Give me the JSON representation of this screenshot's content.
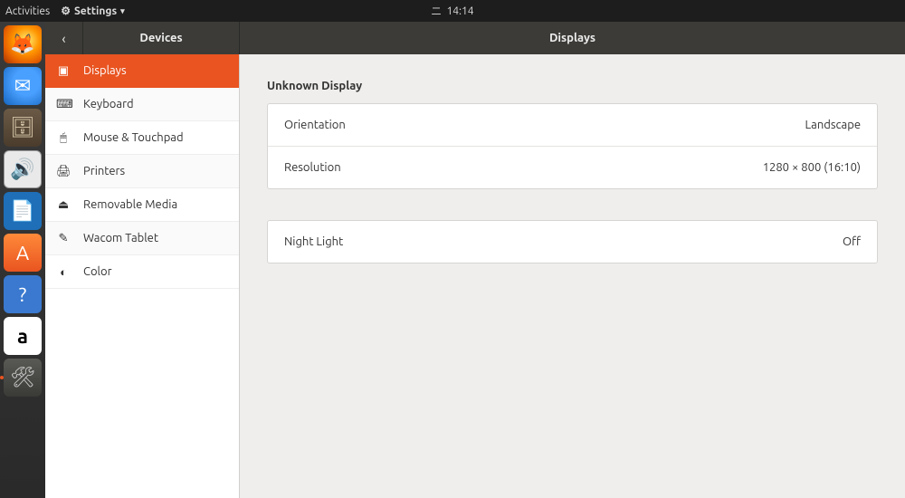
{
  "topbar": {
    "activities": "Activities",
    "app_menu_label": "Settings",
    "time": "14:14",
    "day_glyph": "二"
  },
  "dock": {
    "items": [
      {
        "name": "firefox"
      },
      {
        "name": "thunderbird"
      },
      {
        "name": "files"
      },
      {
        "name": "rhythmbox"
      },
      {
        "name": "libreoffice-writer"
      },
      {
        "name": "ubuntu-software"
      },
      {
        "name": "help"
      },
      {
        "name": "amazon"
      },
      {
        "name": "settings"
      }
    ]
  },
  "header": {
    "sidebar_title": "Devices",
    "main_title": "Displays"
  },
  "sidebar": {
    "items": [
      {
        "label": "Displays"
      },
      {
        "label": "Keyboard"
      },
      {
        "label": "Mouse & Touchpad"
      },
      {
        "label": "Printers"
      },
      {
        "label": "Removable Media"
      },
      {
        "label": "Wacom Tablet"
      },
      {
        "label": "Color"
      }
    ]
  },
  "content": {
    "section_title": "Unknown Display",
    "rows": [
      {
        "label": "Orientation",
        "value": "Landscape"
      },
      {
        "label": "Resolution",
        "value": "1280 × 800 (16:10)"
      }
    ],
    "night_light": {
      "label": "Night Light",
      "value": "Off"
    }
  }
}
